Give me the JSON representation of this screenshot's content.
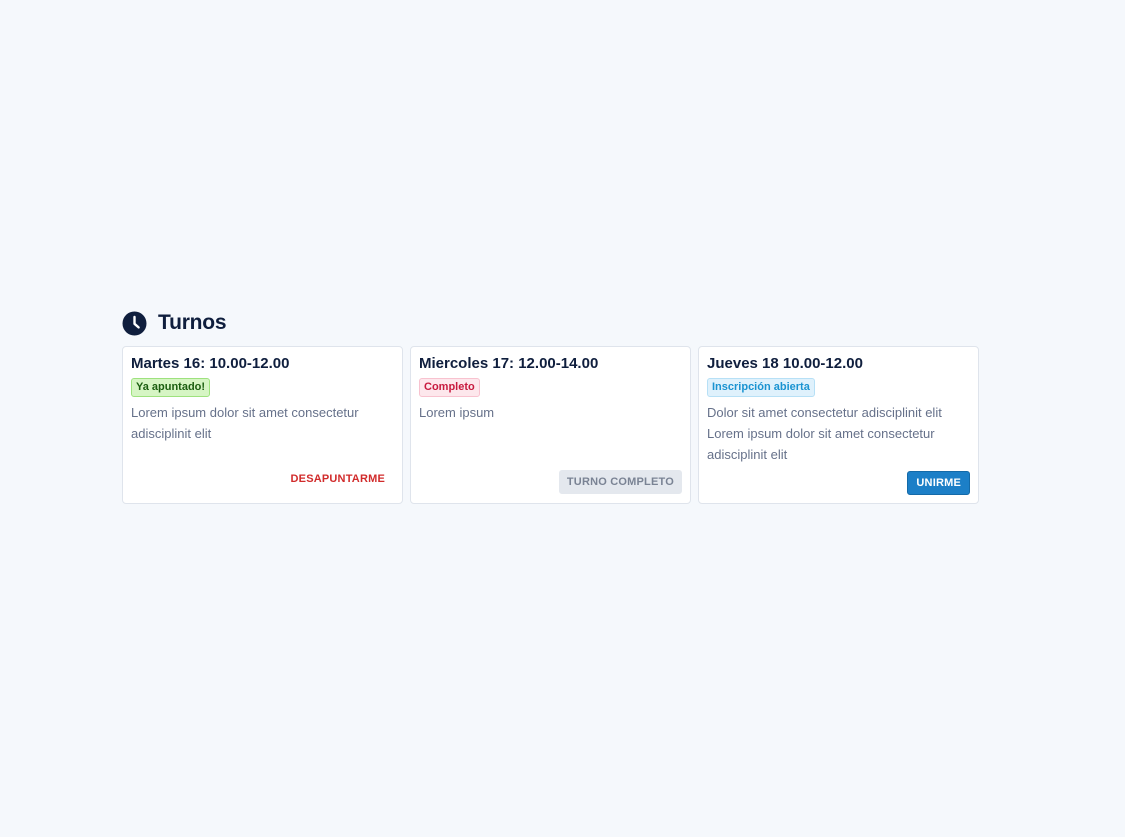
{
  "section": {
    "title": "Turnos",
    "icon": "clock-icon"
  },
  "colors": {
    "heading": "#0f1e3d",
    "primary": "#1c7fc7",
    "danger": "#d12b2b"
  },
  "cards": [
    {
      "title": "Martes 16: 10.00-12.00",
      "badge": "Ya apuntado!",
      "description": "Lorem ipsum dolor sit amet consectetur adisciplinit elit",
      "action": "DESAPUNTARME"
    },
    {
      "title": "Miercoles 17: 12.00-14.00",
      "badge": "Completo",
      "description": "Lorem ipsum",
      "action": "TURNO COMPLETO"
    },
    {
      "title": "Jueves 18 10.00-12.00",
      "badge": "Inscripción abierta",
      "description": "Dolor sit amet consectetur adisciplinit elit Lorem ipsum dolor sit amet consectetur adisciplinit elit",
      "action": "UNIRME"
    }
  ]
}
